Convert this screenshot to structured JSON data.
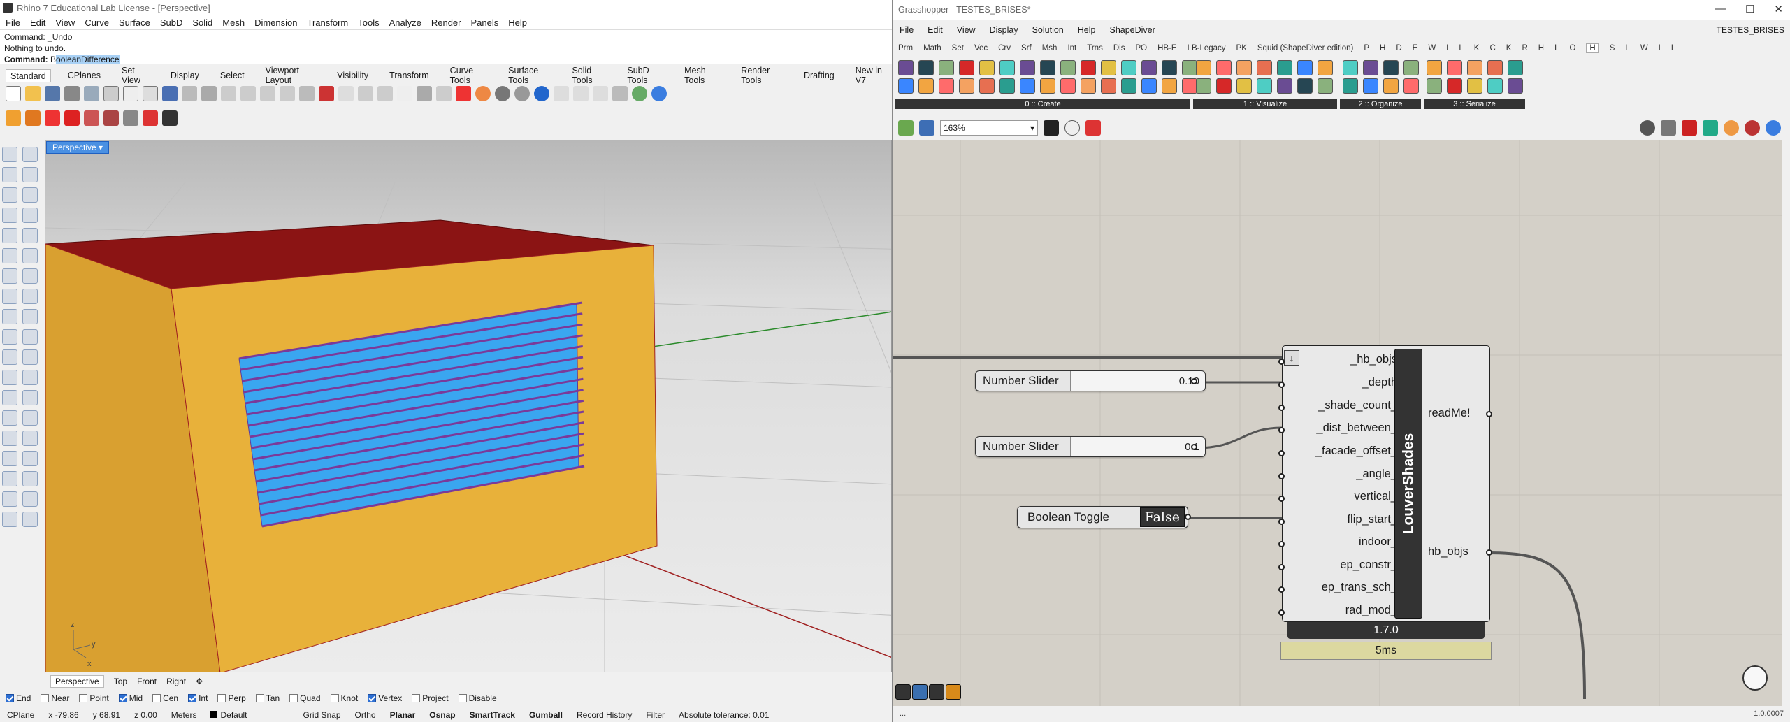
{
  "rhino": {
    "title": "Rhino 7 Educational Lab License - [Perspective]",
    "menu": [
      "File",
      "Edit",
      "View",
      "Curve",
      "Surface",
      "SubD",
      "Solid",
      "Mesh",
      "Dimension",
      "Transform",
      "Tools",
      "Analyze",
      "Render",
      "Panels",
      "Help"
    ],
    "command_history": [
      "Command: _Undo",
      "Nothing to undo."
    ],
    "command_prompt_label": "Command: ",
    "command_prompt_first": "B",
    "command_prompt_selected": "ooleanDifference",
    "toolbar_tabs": [
      "Standard",
      "CPlanes",
      "Set View",
      "Display",
      "Select",
      "Viewport Layout",
      "Visibility",
      "Transform",
      "Curve Tools",
      "Surface Tools",
      "Solid Tools",
      "SubD Tools",
      "Mesh Tools",
      "Render Tools",
      "Drafting",
      "New in V7"
    ],
    "viewport_label": "Perspective",
    "viewport_tabs": [
      "Perspective",
      "Top",
      "Front",
      "Right",
      "✥"
    ],
    "axis_labels": {
      "z": "z",
      "x": "x",
      "y": "y"
    },
    "osnaps": [
      {
        "label": "End",
        "on": true
      },
      {
        "label": "Near",
        "on": false
      },
      {
        "label": "Point",
        "on": false
      },
      {
        "label": "Mid",
        "on": true
      },
      {
        "label": "Cen",
        "on": false
      },
      {
        "label": "Int",
        "on": true
      },
      {
        "label": "Perp",
        "on": false
      },
      {
        "label": "Tan",
        "on": false
      },
      {
        "label": "Quad",
        "on": false
      },
      {
        "label": "Knot",
        "on": false
      },
      {
        "label": "Vertex",
        "on": true
      },
      {
        "label": "Project",
        "on": false
      },
      {
        "label": "Disable",
        "on": false
      }
    ],
    "status": {
      "cplane": "CPlane",
      "x": "x -79.86",
      "y": "y 68.91",
      "z": "z 0.00",
      "units": "Meters",
      "layer": "Default",
      "grid_snap": "Grid Snap",
      "ortho": "Ortho",
      "planar": "Planar",
      "osnap": "Osnap",
      "smarttrack": "SmartTrack",
      "gumball": "Gumball",
      "record_history": "Record History",
      "filter": "Filter",
      "tolerance": "Absolute tolerance: 0.01"
    },
    "colors": {
      "wall": "#e8b13a",
      "roof": "#8b1414",
      "louver": "#3aa6f0",
      "louver_edge": "#7a3a9a"
    }
  },
  "gh": {
    "title": "Grasshopper - TESTES_BRISES*",
    "doc_name": "TESTES_BRISES",
    "menu": [
      "File",
      "Edit",
      "View",
      "Display",
      "Solution",
      "Help",
      "ShapeDiver"
    ],
    "tabs": [
      "Prm",
      "Math",
      "Set",
      "Vec",
      "Crv",
      "Srf",
      "Msh",
      "Int",
      "Trns",
      "Dis",
      "PO",
      "HB-E",
      "LB-Legacy",
      "PK",
      "Squid (ShapeDiver edition)",
      "P",
      "H",
      "D",
      "E",
      "W",
      "I",
      "L",
      "K",
      "C",
      "K",
      "R",
      "H",
      "L",
      "O",
      "H",
      "S",
      "L",
      "W",
      "I",
      "L"
    ],
    "active_tab_index": 29,
    "ribbon_groups": [
      "0 :: Create",
      "1 :: Visualize",
      "2 :: Organize",
      "3 :: Serialize"
    ],
    "zoom": "163%",
    "sliders": [
      {
        "label": "Number Slider",
        "value": "0.10"
      },
      {
        "label": "Number Slider",
        "value": "0.1"
      }
    ],
    "toggle": {
      "label": "Boolean Toggle",
      "value": "False"
    },
    "component": {
      "name": "LouverShades",
      "inputs": [
        "_hb_objs",
        "_depth",
        "_shade_count_",
        "_dist_between_",
        "_facade_offset_",
        "_angle_",
        "vertical_",
        "flip_start_",
        "indoor_",
        "ep_constr_",
        "ep_trans_sch_",
        "rad_mod_"
      ],
      "outputs": [
        "readMe!",
        "hb_objs"
      ],
      "version": "1.7.0",
      "time": "5ms"
    },
    "footer_left": "...",
    "footer_right": "1.0.0007"
  }
}
